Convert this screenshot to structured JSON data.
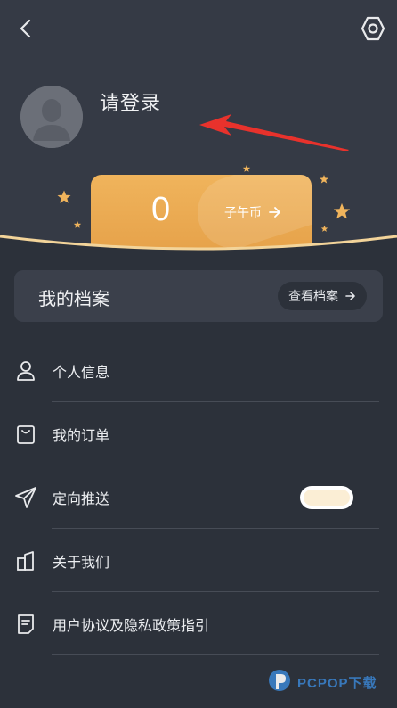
{
  "header": {
    "back_icon": "chevron-left-icon",
    "settings_icon": "hexagon-gear-icon"
  },
  "profile": {
    "login_prompt": "请登录",
    "avatar_icon": "default-avatar-icon"
  },
  "coins": {
    "value": "0",
    "label": "子午币",
    "arrow_icon": "arrow-right-icon"
  },
  "archive": {
    "title": "我的档案",
    "view_button": "查看档案"
  },
  "menu": [
    {
      "label": "个人信息",
      "icon": "user-icon"
    },
    {
      "label": "我的订单",
      "icon": "shopping-bag-icon"
    },
    {
      "label": "定向推送",
      "icon": "paper-plane-icon"
    },
    {
      "label": "关于我们",
      "icon": "building-icon"
    },
    {
      "label": "用户协议及隐私政策指引",
      "icon": "document-icon"
    }
  ],
  "colors": {
    "background": "#2c313a",
    "top_background": "#353a45",
    "accent_gold": "#e6a24a",
    "annotation_red": "#e8322c"
  }
}
